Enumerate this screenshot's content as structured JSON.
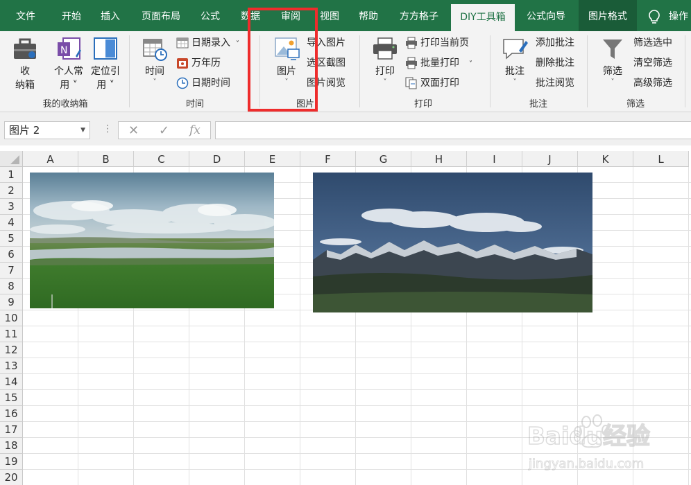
{
  "tabs": [
    "文件",
    "开始",
    "插入",
    "页面布局",
    "公式",
    "数据",
    "审阅",
    "视图",
    "帮助",
    "方方格子",
    "DIY工具箱",
    "公式向导",
    "图片格式",
    "操作"
  ],
  "active_tab": "DIY工具箱",
  "ribbon": {
    "group_mybox": {
      "label": "我的收纳箱",
      "btn_box": "收\n纳箱",
      "btn_box_l1": "收",
      "btn_box_l2": "纳箱",
      "btn_personal": "个人常",
      "btn_personal2": "用",
      "btn_locate": "定位引",
      "btn_locate2": "用"
    },
    "group_time": {
      "label": "时间",
      "btn_time": "时间",
      "date_entry": "日期录入",
      "calendar": "万年历",
      "datetime": "日期时间"
    },
    "group_pic": {
      "label": "图片",
      "btn_pic": "图片",
      "import_pic": "导入图片",
      "region_shot": "选区截图",
      "pic_view": "图片阅览"
    },
    "group_print": {
      "label": "打印",
      "btn_print": "打印",
      "print_page": "打印当前页",
      "batch_print": "批量打印",
      "duplex_print": "双面打印"
    },
    "group_comment": {
      "label": "批注",
      "btn_comment": "批注",
      "add_comment": "添加批注",
      "del_comment": "删除批注",
      "view_comment": "批注阅览"
    },
    "group_filter": {
      "label": "筛选",
      "btn_filter": "筛选",
      "filter_sel": "筛选选中",
      "clear_filter": "清空筛选",
      "adv_filter": "高级筛选"
    }
  },
  "formula_bar": {
    "name_box": "图片 2",
    "cancel": "✕",
    "confirm": "✓",
    "fx": "fx",
    "value": ""
  },
  "columns": [
    "A",
    "B",
    "C",
    "D",
    "E",
    "F",
    "G",
    "H",
    "I",
    "J",
    "K",
    "L"
  ],
  "rows": [
    "1",
    "2",
    "3",
    "4",
    "5",
    "6",
    "7",
    "8",
    "9",
    "10",
    "11",
    "12",
    "13",
    "14",
    "15",
    "16",
    "17",
    "18",
    "19",
    "20"
  ],
  "watermark": {
    "brand": "Baidu经验",
    "url": "jingyan.baidu.com"
  },
  "colors": {
    "excel_green": "#217346",
    "highlight": "#ee2c2c"
  }
}
